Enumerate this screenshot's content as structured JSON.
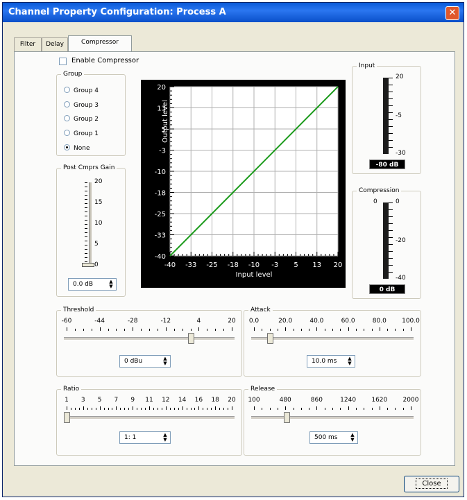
{
  "window": {
    "title": "Channel Property Configuration: Process A",
    "close_glyph": "✕"
  },
  "tabs": [
    {
      "label": "Filter"
    },
    {
      "label": "Delay"
    },
    {
      "label": "Compressor"
    }
  ],
  "compressor": {
    "enable_label": "Enable Compressor",
    "group": {
      "title": "Group",
      "options": [
        "Group 4",
        "Group 3",
        "Group 2",
        "Group 1",
        "None"
      ],
      "selected": "None"
    },
    "post_gain": {
      "title": "Post Cmprs Gain",
      "scale": [
        "20",
        "15",
        "10",
        "5",
        "0"
      ],
      "value": "0.0 dB"
    },
    "graph": {
      "xlabel": "Input level",
      "ylabel": "Output level",
      "xticks": [
        "-40",
        "-33",
        "-25",
        "-18",
        "-10",
        "-3",
        "5",
        "13",
        "20"
      ],
      "yticks": [
        "20",
        "13",
        "5",
        "-3",
        "-10",
        "-18",
        "-25",
        "-33",
        "-40"
      ],
      "line_color": "#1a9a1a"
    },
    "input_meter": {
      "title": "Input",
      "scale": [
        "20",
        "-5",
        "-30"
      ],
      "readout": "-80 dB"
    },
    "compression_meter": {
      "title": "Compression",
      "scale": [
        "0",
        "-20",
        "-40"
      ],
      "readout": "0 dB"
    },
    "threshold": {
      "title": "Threshold",
      "ticks": [
        "-60",
        "-44",
        "-28",
        "-12",
        "4",
        "20"
      ],
      "value": "0 dBu",
      "position": 0.75
    },
    "attack": {
      "title": "Attack",
      "ticks": [
        "0.0",
        "20.0",
        "40.0",
        "60.0",
        "80.0",
        "100.0"
      ],
      "value": "10.0 ms",
      "position": 0.1
    },
    "ratio": {
      "title": "Ratio",
      "ticks": [
        "1",
        "3",
        "5",
        "7",
        "9",
        "11",
        "12",
        "14",
        "16",
        "18",
        "20"
      ],
      "value": "1: 1",
      "position": 0.0
    },
    "release": {
      "title": "Release",
      "ticks": [
        "100",
        "480",
        "860",
        "1240",
        "1620",
        "2000"
      ],
      "value": "500 ms",
      "position": 0.21
    }
  },
  "footer": {
    "close_label": "Close"
  }
}
